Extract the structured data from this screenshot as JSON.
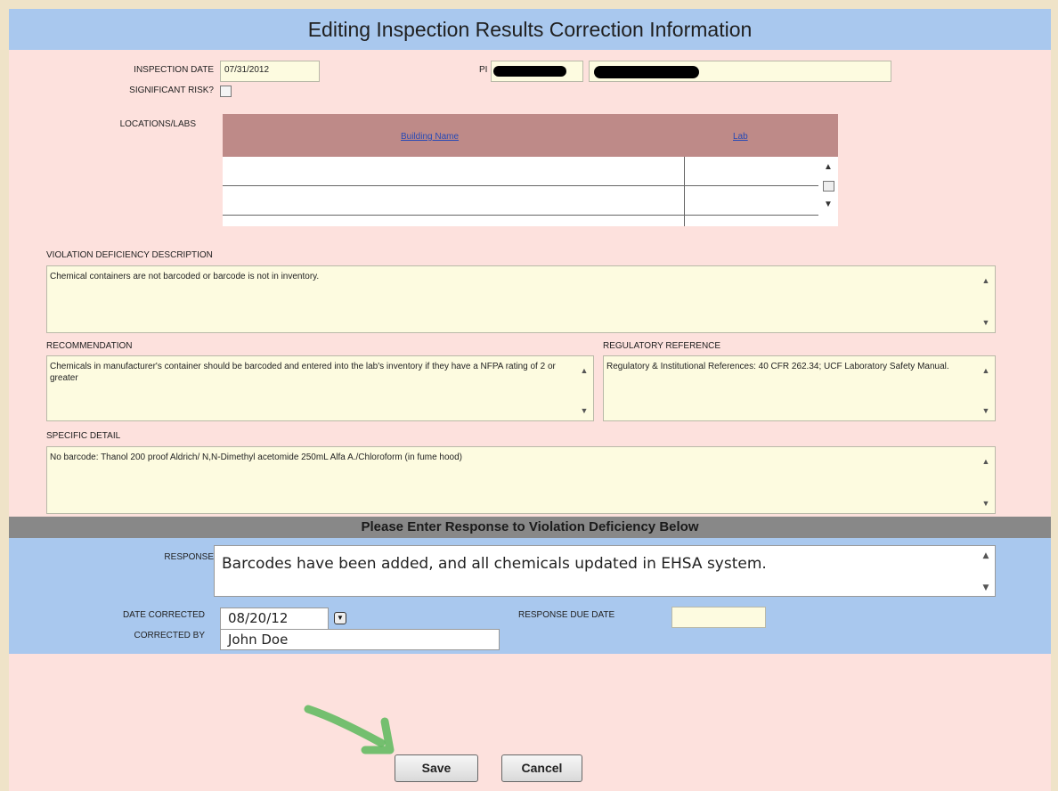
{
  "title": "Editing Inspection Results Correction Information",
  "inspection": {
    "date_label": "INSPECTION DATE",
    "date_value": "07/31/2012",
    "pi_label": "PI",
    "significant_label": "SIGNIFICANT RISK?",
    "locations_label": "LOCATIONS/LABS"
  },
  "grid": {
    "columns": [
      "Building Name",
      "Lab"
    ],
    "rows": [
      [
        "",
        ""
      ],
      [
        "",
        ""
      ]
    ]
  },
  "violation": {
    "label": "VIOLATION DEFICIENCY DESCRIPTION",
    "text": "Chemical containers are not barcoded or barcode is not in inventory."
  },
  "recommendation": {
    "label": "RECOMMENDATION",
    "text": "Chemicals in manufacturer's container should be barcoded and entered into the lab's inventory if they have a NFPA rating of 2 or greater"
  },
  "regulatory": {
    "label": "REGULATORY REFERENCE",
    "text": "Regulatory & Institutional References:  40 CFR 262.34;  UCF Laboratory Safety Manual."
  },
  "detail": {
    "label": "SPECIFIC DETAIL",
    "text": "No barcode: Thanol 200 proof Aldrich/ N,N-Dimethyl acetomide 250mL Alfa A./Chloroform (in fume hood)"
  },
  "response_section": {
    "header": "Please Enter Response to Violation Deficiency Below",
    "response_label": "RESPONSE",
    "response_value": "Barcodes have been added, and all chemicals updated in EHSA system.",
    "date_corrected_label": "DATE CORRECTED",
    "date_corrected_value": "08/20/12",
    "response_due_label": "RESPONSE DUE DATE",
    "response_due_value": "",
    "corrected_by_label": "CORRECTED BY",
    "corrected_by_value": "John Doe"
  },
  "buttons": {
    "save": "Save",
    "cancel": "Cancel"
  },
  "colors": {
    "title_bar": "#a9c8ee",
    "panel": "#fde1dd",
    "grid_header": "#be8a88",
    "field_bg": "#fdfbe0",
    "section_bar": "#888888",
    "annotation_arrow": "#5cb85c"
  },
  "icons": {
    "scroll_up": "▲",
    "scroll_down": "▼",
    "calendar": "▼"
  }
}
